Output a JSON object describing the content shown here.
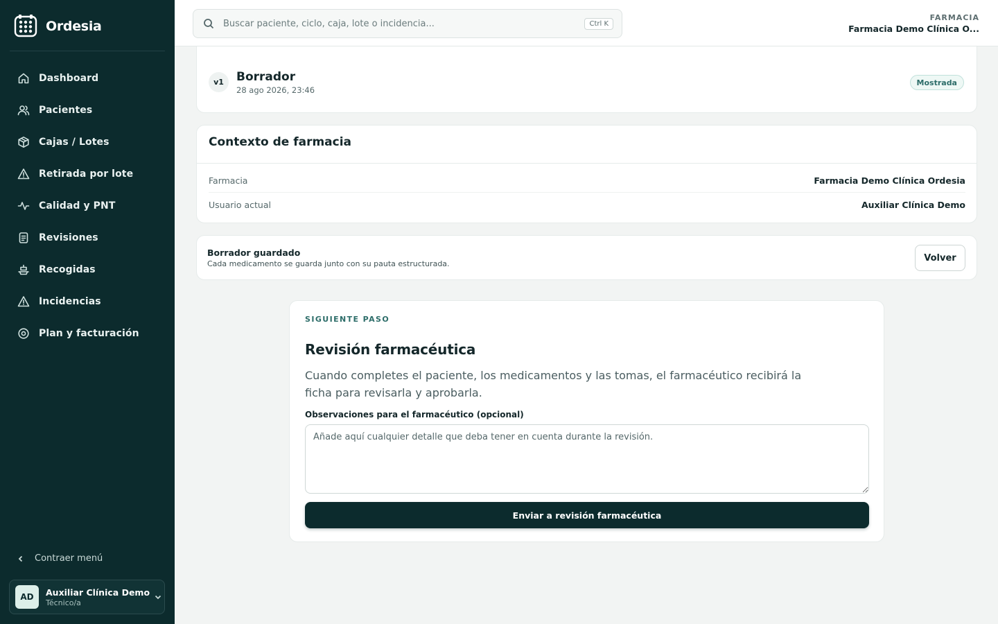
{
  "brand": {
    "name": "Ordesia"
  },
  "sidebar": {
    "items": [
      {
        "label": "Dashboard",
        "icon": "home-icon"
      },
      {
        "label": "Pacientes",
        "icon": "users-icon"
      },
      {
        "label": "Cajas / Lotes",
        "icon": "box-icon"
      },
      {
        "label": "Retirada por lote",
        "icon": "warning-icon"
      },
      {
        "label": "Calidad y PNT",
        "icon": "activity-icon"
      },
      {
        "label": "Revisiones",
        "icon": "clipboard-icon"
      },
      {
        "label": "Recogidas",
        "icon": "pickup-icon"
      },
      {
        "label": "Incidencias",
        "icon": "warning-icon"
      },
      {
        "label": "Plan y facturación",
        "icon": "settings-icon"
      }
    ],
    "collapse_label": "Contraer menú",
    "user": {
      "initials": "AD",
      "name": "Auxiliar Clínica Demo",
      "role": "Técnico/a"
    }
  },
  "topbar": {
    "search_placeholder": "Buscar paciente, ciclo, caja, lote o incidencia...",
    "shortcut": "Ctrl K",
    "pharmacy_eyebrow": "FARMACIA",
    "pharmacy_name": "Farmacia Demo Clínica O..."
  },
  "version": {
    "badge": "v1",
    "title": "Borrador",
    "date": "28 ago 2026, 23:46",
    "status": "Mostrada"
  },
  "context": {
    "title": "Contexto de farmacia",
    "rows": [
      {
        "label": "Farmacia",
        "value": "Farmacia Demo Clínica Ordesia"
      },
      {
        "label": "Usuario actual",
        "value": "Auxiliar Clínica Demo"
      }
    ]
  },
  "saved": {
    "title": "Borrador guardado",
    "subtitle": "Cada medicamento se guarda junto con su pauta estructurada.",
    "back_label": "Volver"
  },
  "next_step": {
    "eyebrow": "SIGUIENTE PASO",
    "title": "Revisión farmacéutica",
    "description": "Cuando completes el paciente, los medicamentos y las tomas, el farmacéutico recibirá la ficha para revisarla y aprobarla.",
    "observations_label": "Observaciones para el farmacéutico (opcional)",
    "observations_placeholder": "Añade aquí cualquier detalle que deba tener en cuenta durante la revisión.",
    "observations_value": "",
    "submit_label": "Enviar a revisión farmacéutica"
  },
  "colors": {
    "sidebar_bg": "#0c2b2d",
    "accent": "#2d6d69",
    "page_bg": "#f2f4f3"
  }
}
